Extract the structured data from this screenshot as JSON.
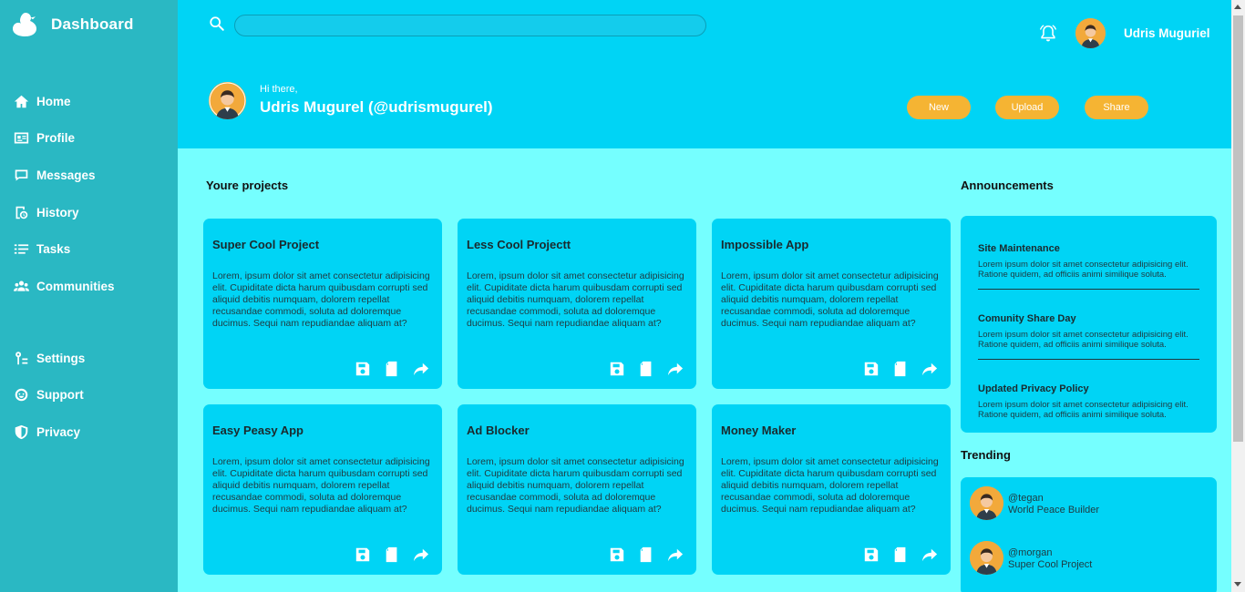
{
  "sidebar": {
    "brand": "Dashboard",
    "items": [
      {
        "label": "Home",
        "icon": "home-icon"
      },
      {
        "label": "Profile",
        "icon": "id-card-icon"
      },
      {
        "label": "Messages",
        "icon": "message-icon"
      },
      {
        "label": "History",
        "icon": "history-icon"
      },
      {
        "label": "Tasks",
        "icon": "tasks-icon"
      },
      {
        "label": "Communities",
        "icon": "users-icon"
      },
      {
        "label": "Settings",
        "icon": "settings-icon"
      },
      {
        "label": "Support",
        "icon": "support-icon"
      },
      {
        "label": "Privacy",
        "icon": "shield-icon"
      }
    ]
  },
  "header": {
    "search": {
      "value": "",
      "placeholder": ""
    },
    "username": "Udris Muguriel",
    "greeting": "Hi there,",
    "full_name": "Udris Mugurel (@udrismugurel)",
    "buttons": {
      "new": "New",
      "upload": "Upload",
      "share": "Share"
    }
  },
  "main": {
    "projects_title": "Youre projects",
    "projects": [
      {
        "title": "Super Cool Project",
        "body": "Lorem, ipsum dolor sit amet consectetur adipisicing elit. Cupiditate dicta harum quibusdam corrupti sed aliquid debitis numquam, dolorem repellat recusandae commodi, soluta ad doloremque ducimus. Sequi nam repudiandae aliquam at?"
      },
      {
        "title": "Less Cool Projectt",
        "body": "Lorem, ipsum dolor sit amet consectetur adipisicing elit. Cupiditate dicta harum quibusdam corrupti sed aliquid debitis numquam, dolorem repellat recusandae commodi, soluta ad doloremque ducimus. Sequi nam repudiandae aliquam at?"
      },
      {
        "title": "Impossible App",
        "body": "Lorem, ipsum dolor sit amet consectetur adipisicing elit. Cupiditate dicta harum quibusdam corrupti sed aliquid debitis numquam, dolorem repellat recusandae commodi, soluta ad doloremque ducimus. Sequi nam repudiandae aliquam at?"
      },
      {
        "title": "Easy Peasy App",
        "body": "Lorem, ipsum dolor sit amet consectetur adipisicing elit. Cupiditate dicta harum quibusdam corrupti sed aliquid debitis numquam, dolorem repellat recusandae commodi, soluta ad doloremque ducimus. Sequi nam repudiandae aliquam at?"
      },
      {
        "title": "Ad Blocker",
        "body": "Lorem, ipsum dolor sit amet consectetur adipisicing elit. Cupiditate dicta harum quibusdam corrupti sed aliquid debitis numquam, dolorem repellat recusandae commodi, soluta ad doloremque ducimus. Sequi nam repudiandae aliquam at?"
      },
      {
        "title": "Money Maker",
        "body": "Lorem, ipsum dolor sit amet consectetur adipisicing elit. Cupiditate dicta harum quibusdam corrupti sed aliquid debitis numquam, dolorem repellat recusandae commodi, soluta ad doloremque ducimus. Sequi nam repudiandae aliquam at?"
      }
    ],
    "announcements_title": "Announcements",
    "announcements": [
      {
        "title": "Site Maintenance",
        "body": "Lorem ipsum dolor sit amet consectetur adipisicing elit. Ratione quidem, ad officiis animi similique soluta."
      },
      {
        "title": "Comunity Share Day",
        "body": "Lorem ipsum dolor sit amet consectetur adipisicing elit. Ratione quidem, ad officiis animi similique soluta."
      },
      {
        "title": "Updated Privacy Policy",
        "body": "Lorem ipsum dolor sit amet consectetur adipisicing elit. Ratione quidem, ad officiis animi similique soluta."
      }
    ],
    "trending_title": "Trending",
    "trending": [
      {
        "handle": "@tegan",
        "project": "World Peace Builder"
      },
      {
        "handle": "@morgan",
        "project": "Super Cool Project"
      }
    ]
  },
  "colors": {
    "sidebar": "#2ab8c3",
    "header": "#00d4f5",
    "page": "#75ffff",
    "accent_button": "#f5b433",
    "avatar": "#f2a93b"
  }
}
